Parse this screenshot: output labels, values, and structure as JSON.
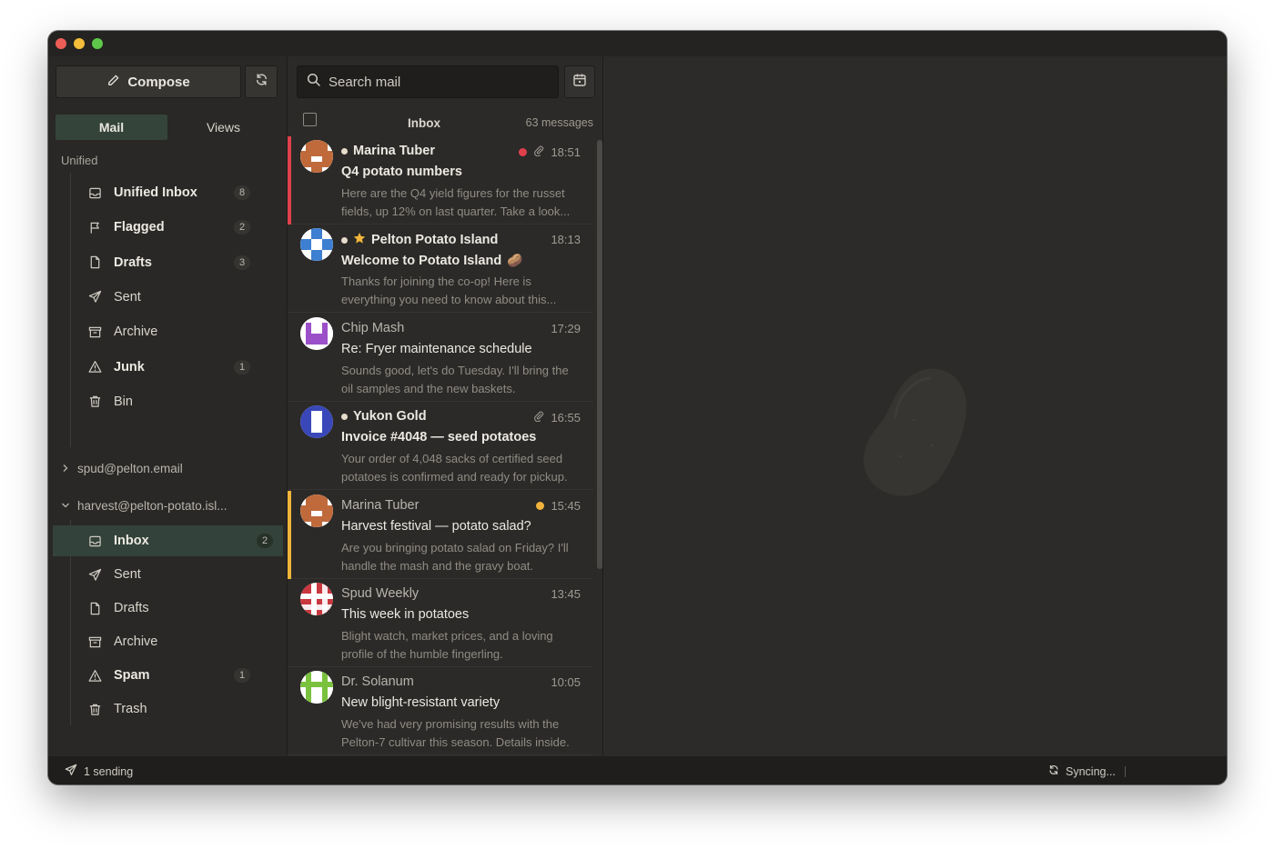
{
  "sidebar": {
    "compose_label": "Compose",
    "tabs": [
      "Mail",
      "Views"
    ],
    "section_label": "Unified",
    "unified_items": [
      {
        "label": "Unified Inbox",
        "count": "8",
        "icon": "inbox-icon",
        "bold": true
      },
      {
        "label": "Flagged",
        "count": "2",
        "icon": "flag-icon",
        "bold": true
      },
      {
        "label": "Drafts",
        "count": "3",
        "icon": "file-icon",
        "bold": true
      },
      {
        "label": "Sent",
        "count": "",
        "icon": "send-icon",
        "bold": false
      },
      {
        "label": "Archive",
        "count": "",
        "icon": "archive-icon",
        "bold": false
      },
      {
        "label": "Junk",
        "count": "1",
        "icon": "warning-icon",
        "bold": true
      },
      {
        "label": "Bin",
        "count": "",
        "icon": "trash-icon",
        "bold": false
      }
    ],
    "accounts": [
      {
        "name": "spud@pelton.email",
        "expanded": false
      },
      {
        "name": "harvest@pelton-potato.isl...",
        "expanded": true
      }
    ],
    "account_items": [
      {
        "label": "Inbox",
        "count": "2",
        "icon": "inbox-icon",
        "bold": true,
        "selected": true
      },
      {
        "label": "Sent",
        "count": "",
        "icon": "send-icon",
        "bold": false
      },
      {
        "label": "Drafts",
        "count": "",
        "icon": "file-icon",
        "bold": false
      },
      {
        "label": "Archive",
        "count": "",
        "icon": "archive-icon",
        "bold": false
      },
      {
        "label": "Spam",
        "count": "1",
        "icon": "warning-icon",
        "bold": true
      },
      {
        "label": "Trash",
        "count": "",
        "icon": "trash-icon",
        "bold": false
      }
    ]
  },
  "list": {
    "search_placeholder": "Search mail",
    "title": "Inbox",
    "count_label": "63 messages",
    "messages": [
      {
        "from": "Marina Tuber",
        "time": "18:51",
        "subject": "Q4 potato numbers",
        "preview": "Here are the Q4 yield figures for the russet fields, up 12% on last quarter. Take a look...",
        "unread": true,
        "strip": "#e0404c",
        "flag_dot": "#e0404c",
        "attachment": true,
        "star": false,
        "emoji": "",
        "avatar": "tuber"
      },
      {
        "from": "Pelton Potato Island",
        "time": "18:13",
        "subject": "Welcome to Potato Island",
        "preview": "Thanks for joining the co-op! Here is everything you need to know about this...",
        "unread": true,
        "strip": "",
        "flag_dot": "",
        "attachment": false,
        "star": true,
        "emoji": "🥔",
        "avatar": "island"
      },
      {
        "from": "Chip Mash",
        "time": "17:29",
        "subject": "Re: Fryer maintenance schedule",
        "preview": "Sounds good, let's do Tuesday. I'll bring the oil samples and the new baskets.",
        "unread": false,
        "strip": "",
        "flag_dot": "",
        "attachment": false,
        "star": false,
        "emoji": "",
        "avatar": "chip"
      },
      {
        "from": "Yukon Gold",
        "time": "16:55",
        "subject": "Invoice #4048 — seed potatoes",
        "preview": "Your order of 4,048 sacks of certified seed potatoes is confirmed and ready for pickup.",
        "unread": true,
        "strip": "",
        "flag_dot": "",
        "attachment": true,
        "star": false,
        "emoji": "",
        "avatar": "yukon"
      },
      {
        "from": "Marina Tuber",
        "time": "15:45",
        "subject": "Harvest festival — potato salad?",
        "preview": "Are you bringing potato salad on Friday? I'll handle the mash and the gravy boat.",
        "unread": false,
        "strip": "#f0b43c",
        "flag_dot": "#f0b43c",
        "attachment": false,
        "star": false,
        "emoji": "",
        "avatar": "tuber"
      },
      {
        "from": "Spud Weekly",
        "time": "13:45",
        "subject": "This week in potatoes",
        "preview": "Blight watch, market prices, and a loving profile of the humble fingerling.",
        "unread": false,
        "strip": "",
        "flag_dot": "",
        "attachment": false,
        "star": false,
        "emoji": "",
        "avatar": "spud"
      },
      {
        "from": "Dr. Solanum",
        "time": "10:05",
        "subject": "New blight-resistant variety",
        "preview": "We've had very promising results with the Pelton-7 cultivar this season. Details inside.",
        "unread": false,
        "strip": "",
        "flag_dot": "",
        "attachment": false,
        "star": false,
        "emoji": "",
        "avatar": "solanum"
      }
    ]
  },
  "status": {
    "sending": "1 sending",
    "syncing": "Syncing..."
  }
}
